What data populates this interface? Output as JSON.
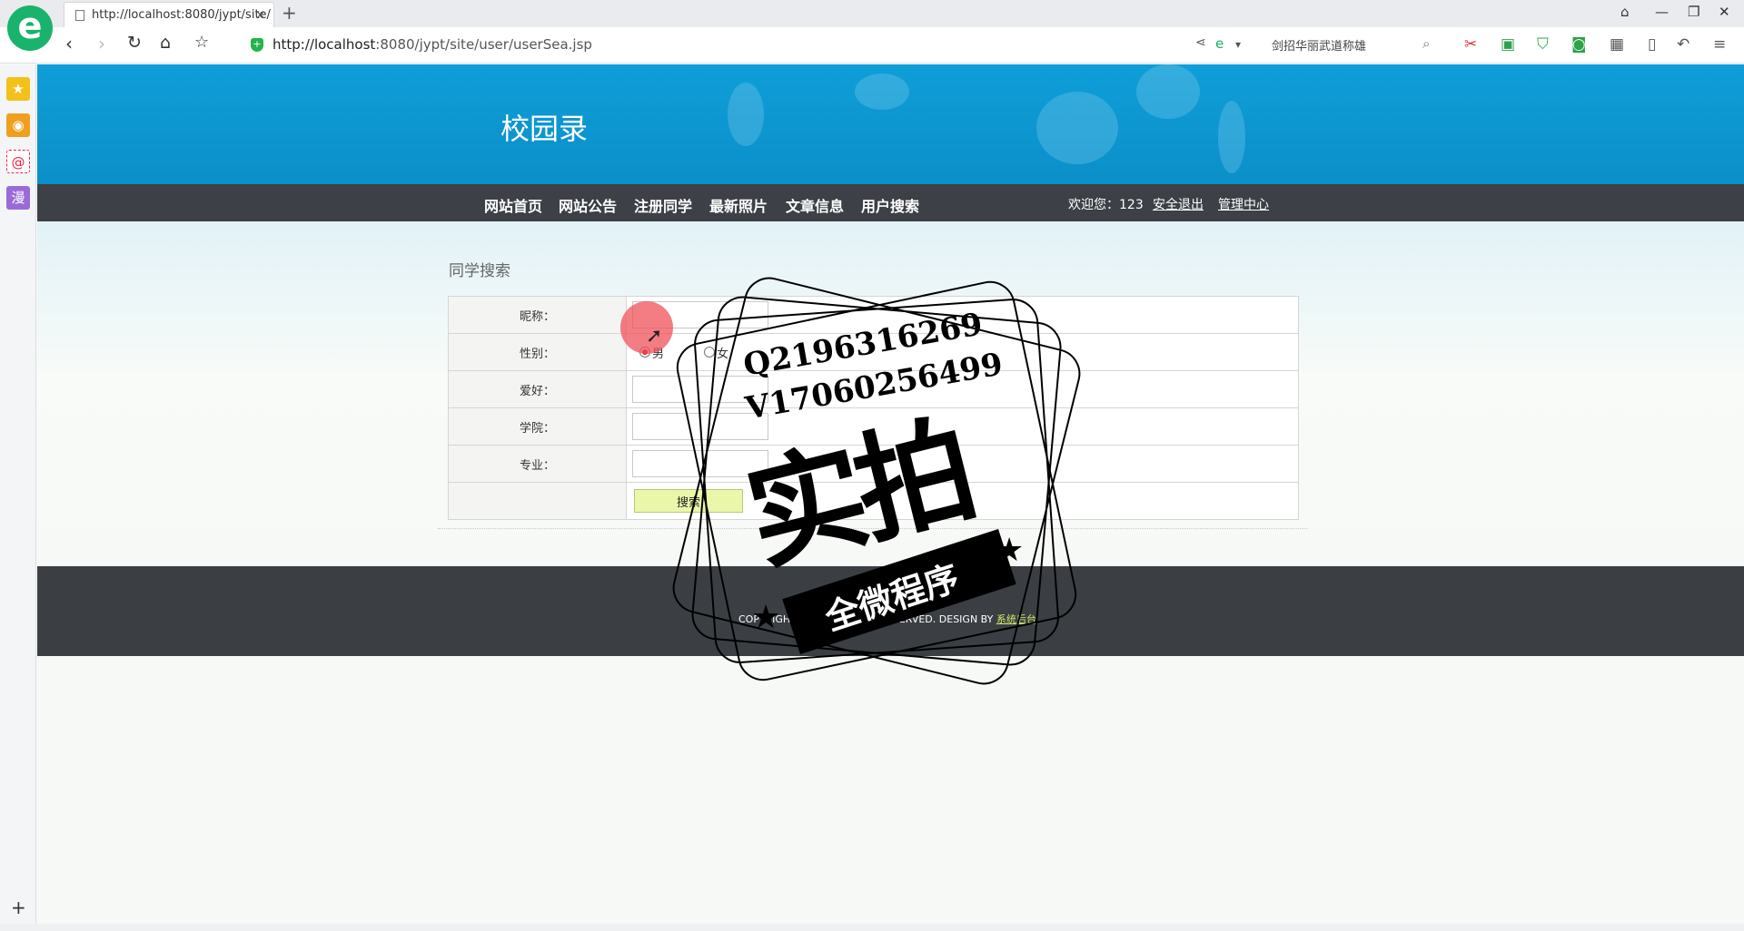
{
  "browser": {
    "tab_title": "http://localhost:8080/jypt/site/",
    "url_host": "http://localhost",
    "url_rest": ":8080/jypt/site/user/userSea.jsp",
    "search_text": "剑招华丽武道称雄",
    "logo_glyph": "e",
    "tab_close": "×",
    "new_tab": "+"
  },
  "site": {
    "title": "校园录",
    "nav": [
      "网站首页",
      "网站公告",
      "注册同学",
      "最新照片",
      "文章信息",
      "用户搜索"
    ],
    "welcome": "欢迎您：123",
    "logout": "安全退出",
    "admin": "管理中心"
  },
  "search": {
    "section_title": "同学搜索",
    "labels": {
      "nickname": "昵称：",
      "gender": "性别：",
      "hobby": "爱好：",
      "college": "学院：",
      "major": "专业："
    },
    "gender_options": [
      "男",
      "女"
    ],
    "gender_selected": "男",
    "button": "搜索"
  },
  "footer": {
    "copyright_prefix": "COPYRIGHT (C) ALL RIGHTS RESERVED. DESIGN BY",
    "designer_link": "系统后台"
  },
  "watermark": {
    "line1": "Q2196316269",
    "line2": "V17060256499",
    "big": "实拍",
    "small": "全微程序"
  },
  "colors": {
    "banner": "#0f9ed8",
    "nav_bar": "#3d4046",
    "footer": "#3b3f44",
    "button": "#eaf7aa"
  }
}
